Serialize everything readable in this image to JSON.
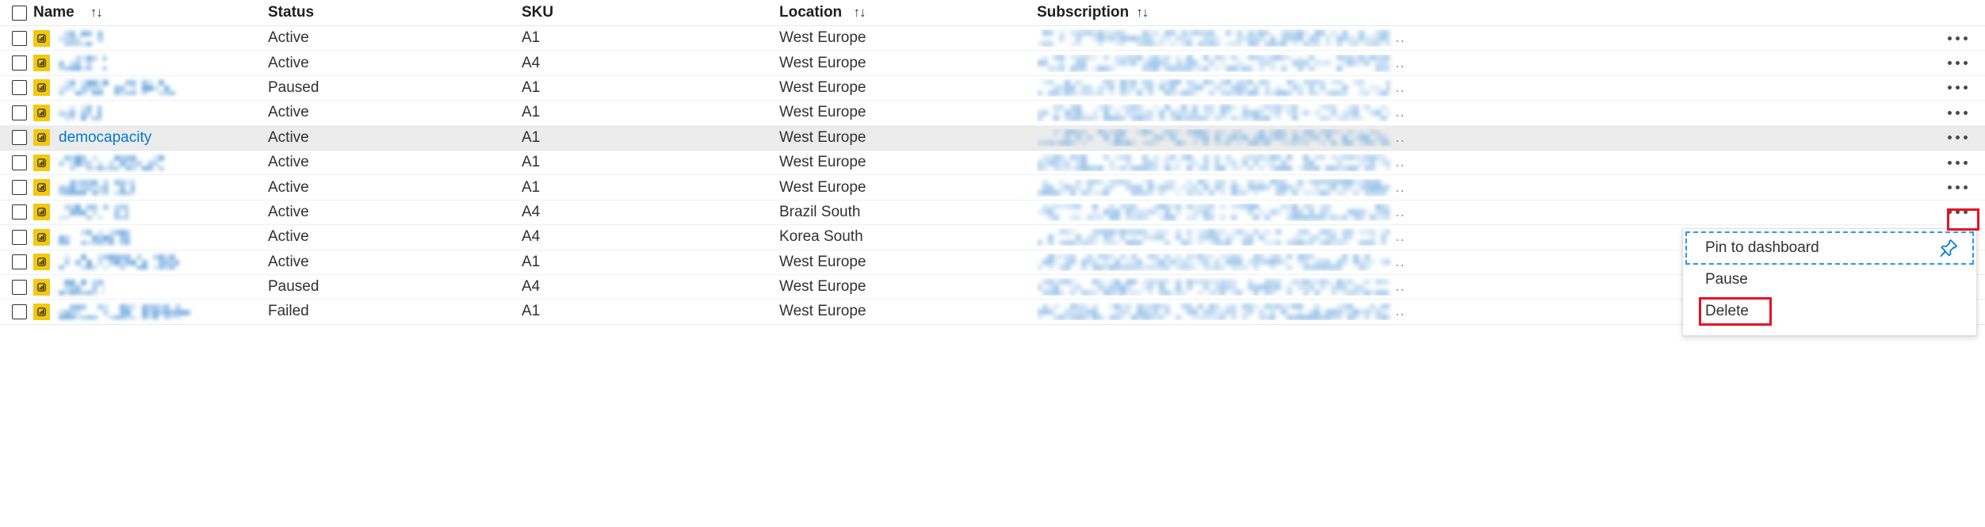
{
  "table": {
    "columns": [
      {
        "key": "name",
        "label": "Name",
        "sortable": true,
        "sort_icon": "sort-asc-desc-icon"
      },
      {
        "key": "status",
        "label": "Status",
        "sortable": false,
        "sort_icon": ""
      },
      {
        "key": "sku",
        "label": "SKU",
        "sortable": false,
        "sort_icon": ""
      },
      {
        "key": "location",
        "label": "Location",
        "sortable": true,
        "sort_icon": "sort-asc-desc-icon"
      },
      {
        "key": "subscription",
        "label": "Subscription",
        "sortable": true,
        "sort_icon": "sort-asc-desc-icon"
      }
    ],
    "sort_glyph": "↑↓",
    "select_all_checkbox": {
      "checked": false,
      "name": "select-all-checkbox"
    },
    "row_icon": "power-bi-capacity-icon",
    "row_menu_glyph": "•••",
    "subscription_truncation": "..",
    "rows": [
      {
        "name": "",
        "redacted": true,
        "name_blur_width": 68,
        "status": "Active",
        "sku": "A1",
        "location": "West Europe",
        "selected": false
      },
      {
        "name": "",
        "redacted": true,
        "name_blur_width": 60,
        "status": "Active",
        "sku": "A4",
        "location": "West Europe",
        "selected": false
      },
      {
        "name": "",
        "redacted": true,
        "name_blur_width": 148,
        "status": "Paused",
        "sku": "A1",
        "location": "West Europe",
        "selected": false
      },
      {
        "name": "",
        "redacted": true,
        "name_blur_width": 54,
        "status": "Active",
        "sku": "A1",
        "location": "West Europe",
        "selected": false
      },
      {
        "name": "democapacity",
        "redacted": false,
        "name_blur_width": 0,
        "status": "Active",
        "sku": "A1",
        "location": "West Europe",
        "selected": true
      },
      {
        "name": "",
        "redacted": true,
        "name_blur_width": 133,
        "status": "Active",
        "sku": "A1",
        "location": "West Europe",
        "selected": false
      },
      {
        "name": "",
        "redacted": true,
        "name_blur_width": 96,
        "status": "Active",
        "sku": "A1",
        "location": "West Europe",
        "selected": false
      },
      {
        "name": "",
        "redacted": true,
        "name_blur_width": 88,
        "status": "Active",
        "sku": "A4",
        "location": "Brazil South",
        "selected": false
      },
      {
        "name": "",
        "redacted": true,
        "name_blur_width": 90,
        "status": "Active",
        "sku": "A4",
        "location": "Korea South",
        "selected": false
      },
      {
        "name": "",
        "redacted": true,
        "name_blur_width": 152,
        "status": "Active",
        "sku": "A1",
        "location": "West Europe",
        "selected": false
      },
      {
        "name": "",
        "redacted": true,
        "name_blur_width": 57,
        "status": "Paused",
        "sku": "A4",
        "location": "West Europe",
        "selected": false
      },
      {
        "name": "",
        "redacted": true,
        "name_blur_width": 166,
        "status": "Failed",
        "sku": "A1",
        "location": "West Europe",
        "selected": false
      }
    ]
  },
  "context_menu": {
    "visible": true,
    "owner_row": "democapacity",
    "items": [
      {
        "label": "Pin to dashboard",
        "icon": "pin-icon",
        "focused": true,
        "highlighted": false
      },
      {
        "label": "Pause",
        "icon": "",
        "focused": false,
        "highlighted": false
      },
      {
        "label": "Delete",
        "icon": "",
        "focused": false,
        "highlighted": true
      }
    ]
  },
  "annotations": {
    "kebab_highlight": {
      "shape": "rectangle",
      "color": "#e81123",
      "target": "row-menu-button-democapacity"
    },
    "delete_highlight": {
      "shape": "rectangle",
      "color": "#e81123",
      "target": "menu-item-delete"
    }
  },
  "colors": {
    "link": "#0078d4",
    "power_bi_yellow": "#f2c811",
    "selected_row": "#ececec",
    "annotation_red": "#e81123",
    "focus_blue": "#2899f5",
    "text": "#323130"
  }
}
